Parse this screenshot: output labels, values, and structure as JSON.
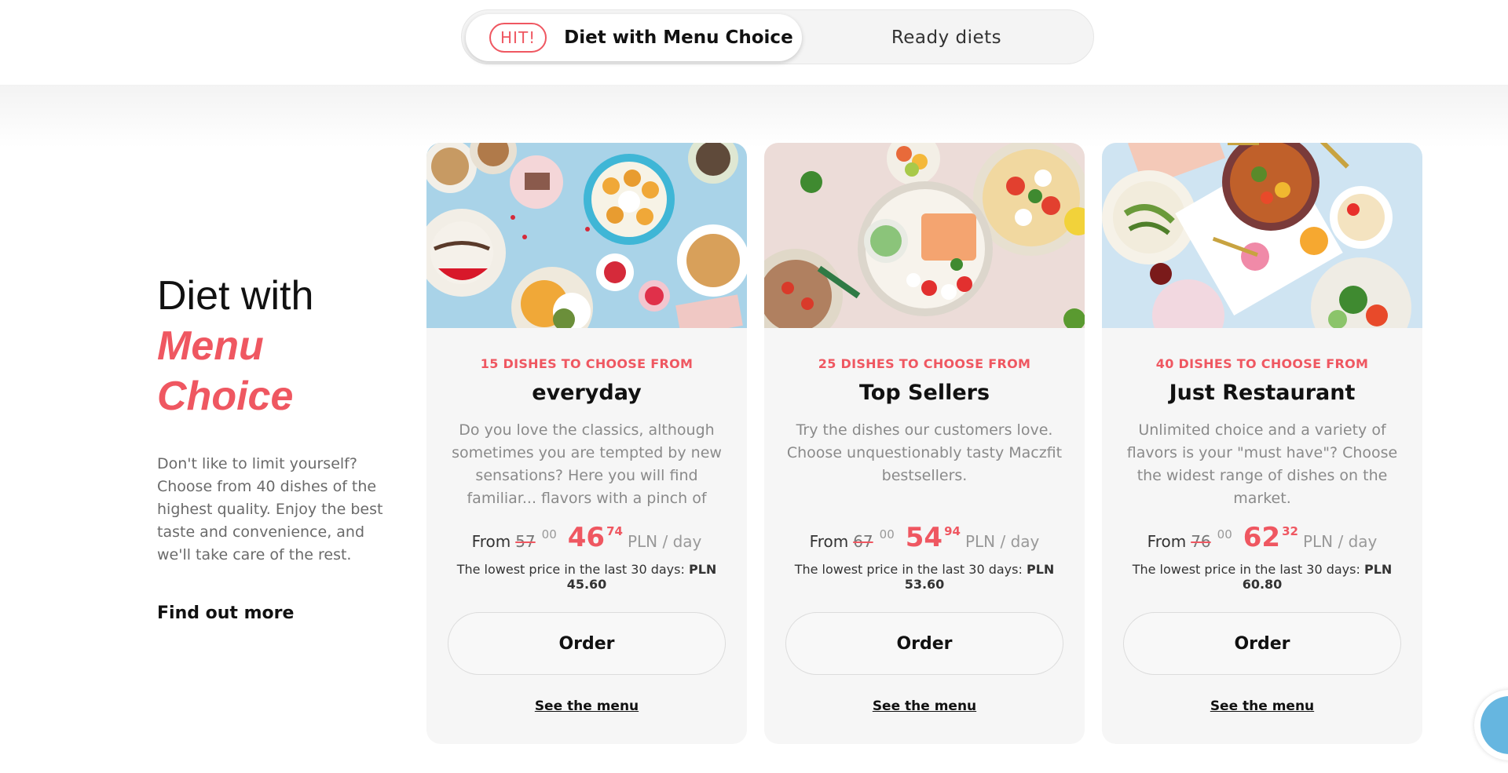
{
  "switcher": {
    "badge": "HIT!",
    "active_label": "Diet with Menu Choice",
    "inactive_label": "Ready diets"
  },
  "intro": {
    "title_line1": "Diet with",
    "title_accent_1": "Menu",
    "title_accent_2": "Choice",
    "description": "Don't like to limit yourself? Choose from 40 dishes of the highest quality. Enjoy the best taste and convenience, and we'll take care of the rest.",
    "link": "Find out more"
  },
  "cards": [
    {
      "kicker": "15 DISHES TO CHOOSE FROM",
      "name": "everyday",
      "description": "Do you love the classics, although sometimes you are tempted by new sensations? Here you will find familiar... flavors with a pinch of fantasy.",
      "from": "From",
      "old_price": "57",
      "old_cents": "00",
      "new_price": "46",
      "new_cents": "74",
      "unit": "PLN / day",
      "lowest_label": "The lowest price in the last 30 days:",
      "lowest_value": "PLN 45.60",
      "order_label": "Order",
      "menu_link": "See the menu"
    },
    {
      "kicker": "25 DISHES TO CHOOSE FROM",
      "name": "Top Sellers",
      "description": "Try the dishes our customers love. Choose unquestionably tasty Maczfit bestsellers.",
      "from": "From",
      "old_price": "67",
      "old_cents": "00",
      "new_price": "54",
      "new_cents": "94",
      "unit": "PLN / day",
      "lowest_label": "The lowest price in the last 30 days:",
      "lowest_value": "PLN 53.60",
      "order_label": "Order",
      "menu_link": "See the menu"
    },
    {
      "kicker": "40 DISHES TO CHOOSE FROM",
      "name": "Just Restaurant",
      "description": "Unlimited choice and a variety of flavors is your \"must have\"? Choose the widest range of dishes on the market.",
      "from": "From",
      "old_price": "76",
      "old_cents": "00",
      "new_price": "62",
      "new_cents": "32",
      "unit": "PLN / day",
      "lowest_label": "The lowest price in the last 30 days:",
      "lowest_value": "PLN 60.80",
      "order_label": "Order",
      "menu_link": "See the menu"
    }
  ],
  "colors": {
    "accent": "#ef5761",
    "card_bg": "#f6f6f6",
    "chat": "#66b6e0"
  },
  "icons": {
    "chat": "chat-icon"
  }
}
